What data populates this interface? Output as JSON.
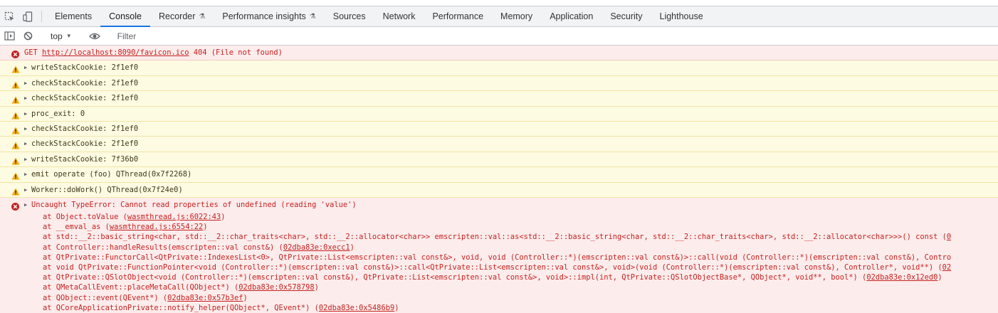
{
  "tabs": [
    {
      "label": "Elements",
      "flask": false
    },
    {
      "label": "Console",
      "flask": false,
      "active": true
    },
    {
      "label": "Recorder",
      "flask": true
    },
    {
      "label": "Performance insights",
      "flask": true
    },
    {
      "label": "Sources",
      "flask": false
    },
    {
      "label": "Network",
      "flask": false
    },
    {
      "label": "Performance",
      "flask": false
    },
    {
      "label": "Memory",
      "flask": false
    },
    {
      "label": "Application",
      "flask": false
    },
    {
      "label": "Security",
      "flask": false
    },
    {
      "label": "Lighthouse",
      "flask": false
    }
  ],
  "toolbar": {
    "context": "top",
    "filter_placeholder": "Filter"
  },
  "messages": [
    {
      "level": "error",
      "text_prefix": "GET ",
      "link": "http://localhost:8090/favicon.ico",
      "text_suffix": " 404 (File not found)",
      "expandable": false
    },
    {
      "level": "warn",
      "text": "writeStackCookie: 2f1ef0",
      "expandable": true
    },
    {
      "level": "warn",
      "text": "checkStackCookie: 2f1ef0",
      "expandable": true
    },
    {
      "level": "warn",
      "text": "checkStackCookie: 2f1ef0",
      "expandable": true
    },
    {
      "level": "warn",
      "text": "proc_exit: 0",
      "expandable": true
    },
    {
      "level": "warn",
      "text": "checkStackCookie: 2f1ef0",
      "expandable": true
    },
    {
      "level": "warn",
      "text": "checkStackCookie: 2f1ef0",
      "expandable": true
    },
    {
      "level": "warn",
      "text": "writeStackCookie: 7f36b0",
      "expandable": true
    },
    {
      "level": "warn",
      "text": "emit operate (foo) QThread(0x7f2268)",
      "expandable": true
    },
    {
      "level": "warn",
      "text": "Worker::doWork() QThread(0x7f24e0)",
      "expandable": true
    }
  ],
  "exception": {
    "header": "Uncaught TypeError: Cannot read properties of undefined (reading 'value')",
    "frames": [
      {
        "text": "at Object.toValue (",
        "link": "wasmthread.js:6022:43",
        "tail": ")"
      },
      {
        "text": "at __emval_as (",
        "link": "wasmthread.js:6554:22",
        "tail": ")"
      },
      {
        "text": "at std::__2::basic_string<char, std::__2::char_traits<char>, std::__2::allocator<char>> emscripten::val::as<std::__2::basic_string<char, std::__2::char_traits<char>, std::__2::allocator<char>>>() const (",
        "link": "0",
        "tail": ""
      },
      {
        "text": "at Controller::handleResults(emscripten::val const&) (",
        "link": "02dba83e:0xecc1",
        "tail": ")"
      },
      {
        "text": "at QtPrivate::FunctorCall<QtPrivate::IndexesList<0>, QtPrivate::List<emscripten::val const&>, void, void (Controller::*)(emscripten::val const&)>::call(void (Controller::*)(emscripten::val const&), Contro",
        "link": "",
        "tail": ""
      },
      {
        "text": "at void QtPrivate::FunctionPointer<void (Controller::*)(emscripten::val const&)>::call<QtPrivate::List<emscripten::val const&>, void>(void (Controller::*)(emscripten::val const&), Controller*, void**) (",
        "link": "02",
        "tail": ""
      },
      {
        "text": "at QtPrivate::QSlotObject<void (Controller::*)(emscripten::val const&), QtPrivate::List<emscripten::val const&>, void>::impl(int, QtPrivate::QSlotObjectBase*, QObject*, void**, bool*) (",
        "link": "02dba83e:0x12ed0",
        "tail": ")"
      },
      {
        "text": "at QMetaCallEvent::placeMetaCall(QObject*) (",
        "link": "02dba83e:0x578798",
        "tail": ")"
      },
      {
        "text": "at QObject::event(QEvent*) (",
        "link": "02dba83e:0x57b3ef",
        "tail": ")"
      },
      {
        "text": "at QCoreApplicationPrivate::notify_helper(QObject*, QEvent*) (",
        "link": "02dba83e:0x5486b9",
        "tail": ")"
      }
    ]
  },
  "colors": {
    "error": "#c5221f",
    "warning": "#f9ab00",
    "accent": "#1a73e8"
  }
}
